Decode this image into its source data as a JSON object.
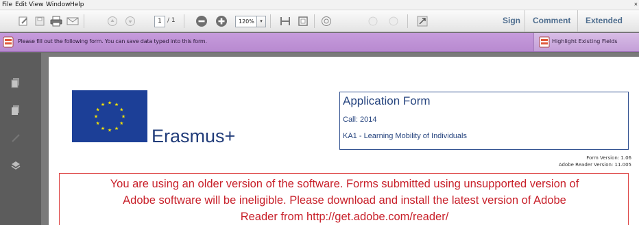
{
  "menu": {
    "items": [
      "File",
      "Edit",
      "View",
      "Window",
      "Help"
    ],
    "close_glyph": "×"
  },
  "toolbar": {
    "icons": [
      "create-icon",
      "save-icon",
      "print-icon",
      "email-icon",
      "previous-page-icon",
      "next-page-icon",
      "zoom-out-icon",
      "zoom-in-icon",
      "fit-width-icon",
      "fit-page-icon",
      "comment-bubble-icon",
      "fullscreen-icon"
    ],
    "page_current": "1",
    "page_total": "/ 1",
    "zoom_value": "120%",
    "zoom_dropdown_glyph": "▾",
    "tabs": [
      "Sign",
      "Comment",
      "Extended"
    ],
    "tab_color": "#4f6e8f"
  },
  "form_bar": {
    "message": "Please fill out the following form. You can save data typed into this form.",
    "highlight_label": "Highlight Existing Fields",
    "bar_color": "#c195d9"
  },
  "left_rail": {
    "icons": [
      "page-thumbnails-icon",
      "attachments-icon",
      "signatures-icon",
      "layers-icon"
    ]
  },
  "document": {
    "logo_text": "Erasmus+",
    "app_title": "Application Form",
    "call": "Call: 2014",
    "action": "KA1 - Learning Mobility of Individuals",
    "form_version": "Form Version: 1.06",
    "reader_version": "Adobe Reader Version: 11.005",
    "warning_lines": [
      "You are using an older version of the software. Forms submitted using unsupported version of",
      "Adobe software will be ineligible. Please download and install the latest version of Adobe",
      "Reader from http://get.adobe.com/reader/"
    ],
    "warning_color": "#c8202a",
    "title_color": "#27457f",
    "flag_color": "#1c3f97",
    "star_color": "#f8e300"
  }
}
